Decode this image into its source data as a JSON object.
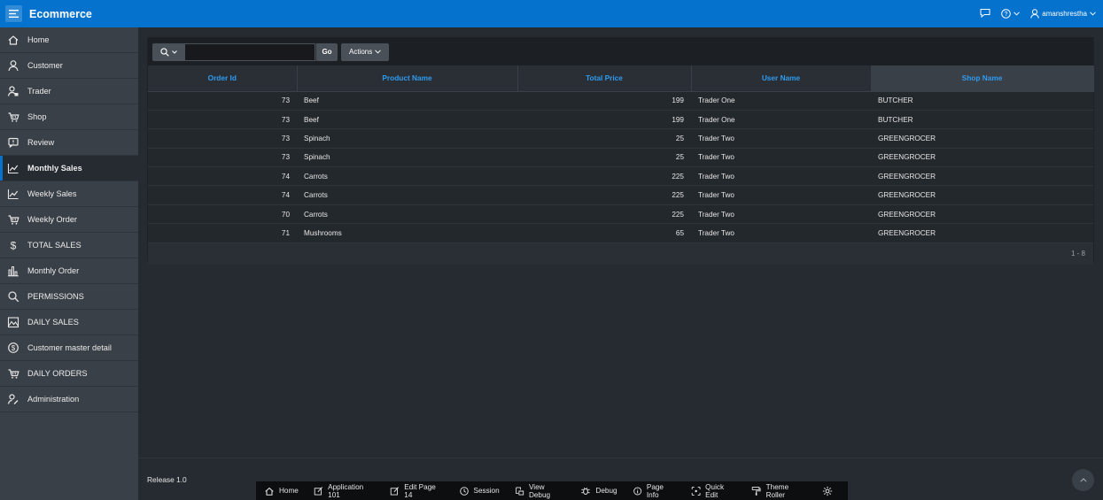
{
  "header": {
    "app_title": "Ecommerce",
    "username": "amanshrestha",
    "accent_color": "#0572ce"
  },
  "sidebar": {
    "items": [
      {
        "label": "Home",
        "icon": "home-icon"
      },
      {
        "label": "Customer",
        "icon": "user-icon"
      },
      {
        "label": "Trader",
        "icon": "user-group-icon"
      },
      {
        "label": "Shop",
        "icon": "cart-icon"
      },
      {
        "label": "Review",
        "icon": "comment-icon"
      },
      {
        "label": "Monthly Sales",
        "icon": "line-chart-icon",
        "active": true
      },
      {
        "label": "Weekly Sales",
        "icon": "line-chart-icon"
      },
      {
        "label": "Weekly Order",
        "icon": "cart-icon"
      },
      {
        "label": "TOTAL SALES",
        "icon": "dollar-icon"
      },
      {
        "label": "Monthly Order",
        "icon": "bar-chart-icon"
      },
      {
        "label": "PERMISSIONS",
        "icon": "search-key-icon"
      },
      {
        "label": "DAILY SALES",
        "icon": "area-chart-icon"
      },
      {
        "label": "Customer master detail",
        "icon": "gear-dollar-icon"
      },
      {
        "label": "DAILY ORDERS",
        "icon": "cart-icon"
      },
      {
        "label": "Administration",
        "icon": "user-wrench-icon"
      }
    ]
  },
  "report": {
    "go_label": "Go",
    "actions_label": "Actions",
    "columns": [
      "Order Id",
      "Product Name",
      "Total Price",
      "User Name",
      "Shop Name"
    ],
    "rows": [
      [
        "73",
        "Beef",
        "199",
        "Trader One",
        "BUTCHER"
      ],
      [
        "73",
        "Beef",
        "199",
        "Trader One",
        "BUTCHER"
      ],
      [
        "73",
        "Spinach",
        "25",
        "Trader Two",
        "GREENGROCER"
      ],
      [
        "73",
        "Spinach",
        "25",
        "Trader Two",
        "GREENGROCER"
      ],
      [
        "74",
        "Carrots",
        "225",
        "Trader Two",
        "GREENGROCER"
      ],
      [
        "74",
        "Carrots",
        "225",
        "Trader Two",
        "GREENGROCER"
      ],
      [
        "70",
        "Carrots",
        "225",
        "Trader Two",
        "GREENGROCER"
      ],
      [
        "71",
        "Mushrooms",
        "65",
        "Trader Two",
        "GREENGROCER"
      ]
    ],
    "pagination": "1 - 8"
  },
  "footer": {
    "release": "Release 1.0",
    "devbar": [
      {
        "label": "Home",
        "icon": "home-icon"
      },
      {
        "label": "Application 101",
        "icon": "edit-icon"
      },
      {
        "label": "Edit Page 14",
        "icon": "edit-icon"
      },
      {
        "label": "Session",
        "icon": "clock-icon"
      },
      {
        "label": "View Debug",
        "icon": "debug-view-icon"
      },
      {
        "label": "Debug",
        "icon": "bug-icon"
      },
      {
        "label": "Page Info",
        "icon": "info-icon"
      },
      {
        "label": "Quick Edit",
        "icon": "quick-edit-icon"
      },
      {
        "label": "Theme Roller",
        "icon": "paint-roller-icon"
      }
    ]
  }
}
